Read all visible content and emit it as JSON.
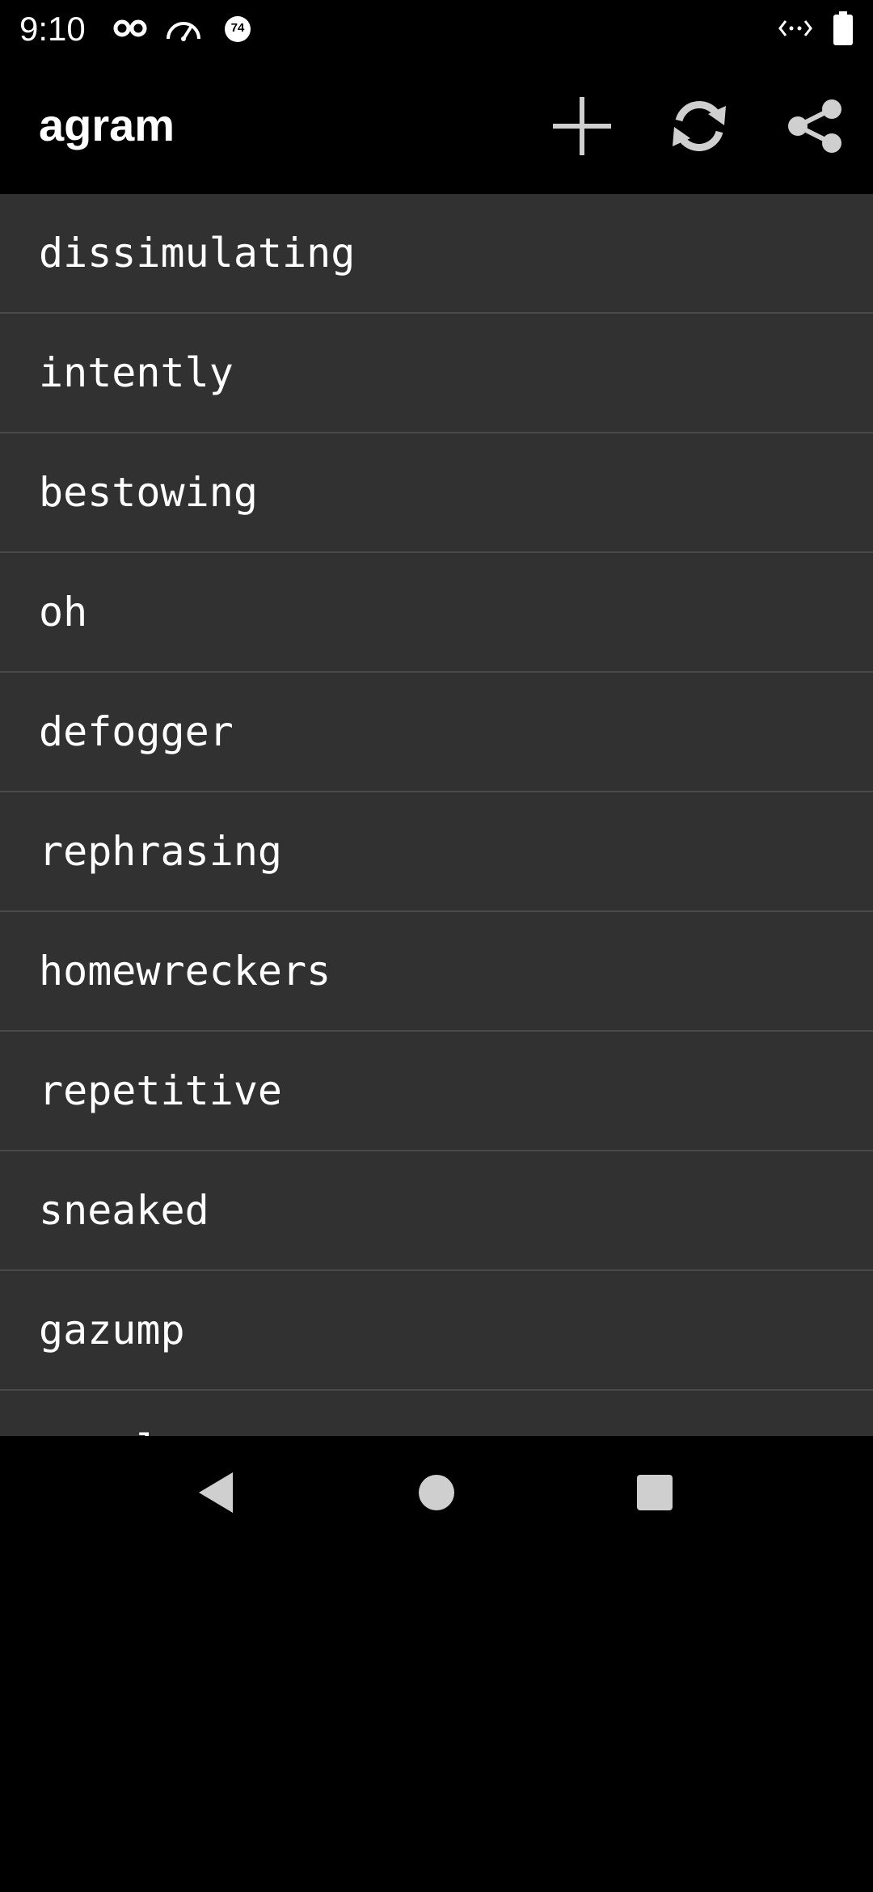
{
  "status_bar": {
    "time": "9:10",
    "badge_number": "74",
    "icons": [
      "incognito-icon",
      "speedometer-icon",
      "badge-icon",
      "data-arrows-icon",
      "battery-icon"
    ]
  },
  "app_bar": {
    "title": "agram",
    "actions": [
      "add-icon",
      "refresh-icon",
      "share-icon"
    ]
  },
  "words": [
    "dissimulating",
    "intently",
    "bestowing",
    "oh",
    "defogger",
    "rephrasing",
    "homewreckers",
    "repetitive",
    "sneaked",
    "gazump",
    "camel"
  ],
  "nav_bar": {
    "buttons": [
      "back-icon",
      "home-icon",
      "recents-icon"
    ]
  },
  "colors": {
    "background": "#000000",
    "list_background": "#313131",
    "divider": "#4a4a4a",
    "text": "#ffffff",
    "icon": "#cfcfcf"
  }
}
